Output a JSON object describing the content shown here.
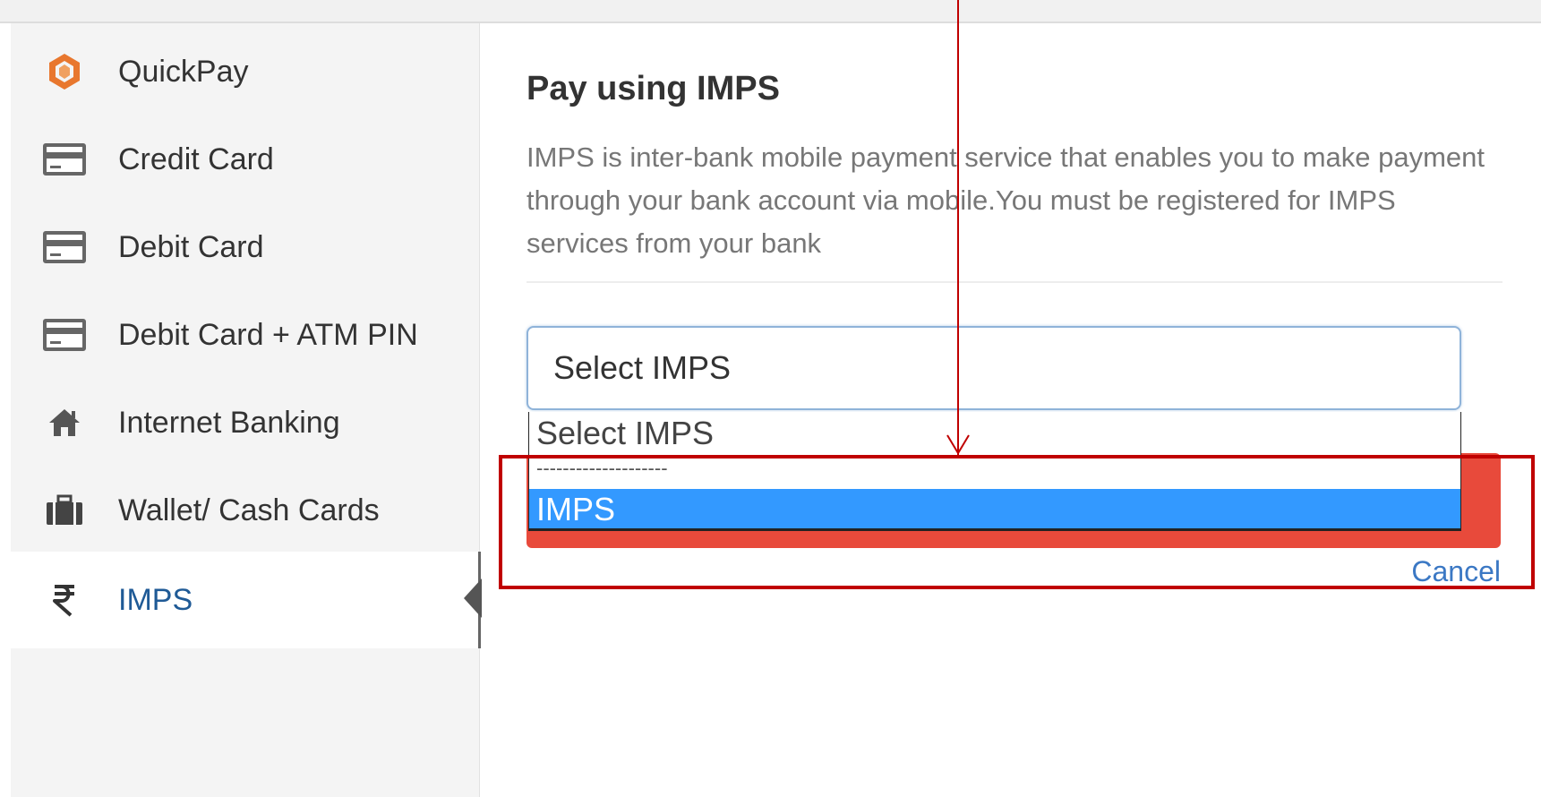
{
  "sidebar": {
    "items": [
      {
        "label": "QuickPay",
        "icon": "quickpay-hexagon-icon",
        "active": false
      },
      {
        "label": "Credit Card",
        "icon": "credit-card-icon",
        "active": false
      },
      {
        "label": "Debit Card",
        "icon": "debit-card-icon",
        "active": false
      },
      {
        "label": "Debit Card + ATM PIN",
        "icon": "atm-card-icon",
        "active": false
      },
      {
        "label": "Internet Banking",
        "icon": "home-icon",
        "active": false
      },
      {
        "label": "Wallet/ Cash Cards",
        "icon": "briefcase-icon",
        "active": false
      },
      {
        "label": "IMPS",
        "icon": "rupee-icon",
        "active": true
      }
    ]
  },
  "main": {
    "title": "Pay using IMPS",
    "description": "IMPS is inter-bank mobile payment service that enables you to make payment through your bank account via mobile.You must be registered for IMPS services from your bank",
    "select": {
      "value": "Select IMPS",
      "options": [
        "Select IMPS",
        "--------------------",
        "IMPS"
      ],
      "highlighted_option": "IMPS"
    },
    "cancel_label": "Cancel"
  },
  "colors": {
    "accent_blue": "#1f5a96",
    "pay_button": "#e84a3b",
    "option_highlight": "#3399ff",
    "annotation_red": "#c00000",
    "quickpay_orange": "#e8772e"
  }
}
